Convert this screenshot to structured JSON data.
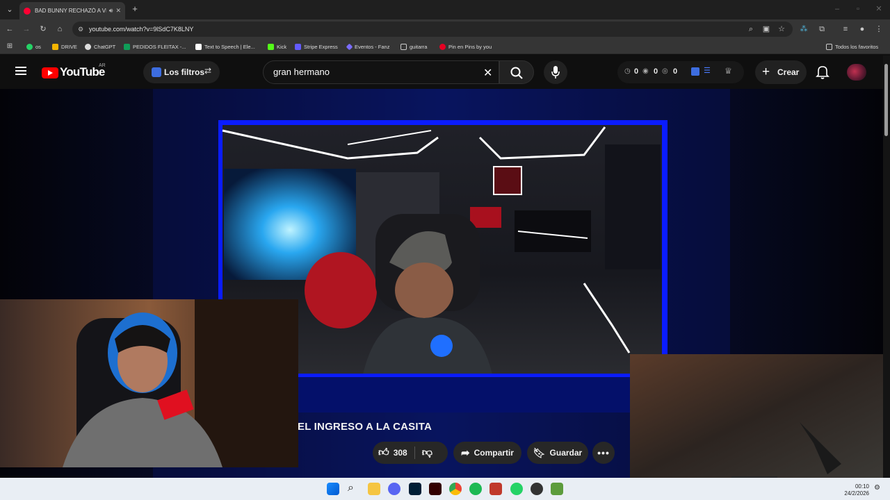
{
  "browser": {
    "tab_title": "BAD BUNNY RECHAZÓ A VE",
    "url": "youtube.com/watch?v=9lSdC7K8LNY",
    "bookmarks": [
      "os",
      "DRIVE",
      "ChatGPT",
      "PEDIDOS FLEITAX -...",
      "Text to Speech | Ele...",
      "Kick",
      "Stripe Express",
      "Eventos - Fanz",
      "guitarra",
      "Pin en Pins by you"
    ],
    "all_bookmarks": "Todos los favoritos"
  },
  "youtube": {
    "logo": "YouTube",
    "country": "AR",
    "filters_label": "Los filtros",
    "search_value": "gran hermano",
    "counters": [
      "0",
      "0",
      "0"
    ],
    "create_label": "Crear"
  },
  "video": {
    "title": "EL INGRESO A LA CASITA",
    "likes": "308",
    "share_label": "Compartir",
    "save_label": "Guardar"
  },
  "taskbar": {
    "time": "00:10",
    "date": "24/2/2026"
  },
  "colors": {
    "neon_blue": "#0a1cff",
    "youtube_red": "#ff0000"
  }
}
